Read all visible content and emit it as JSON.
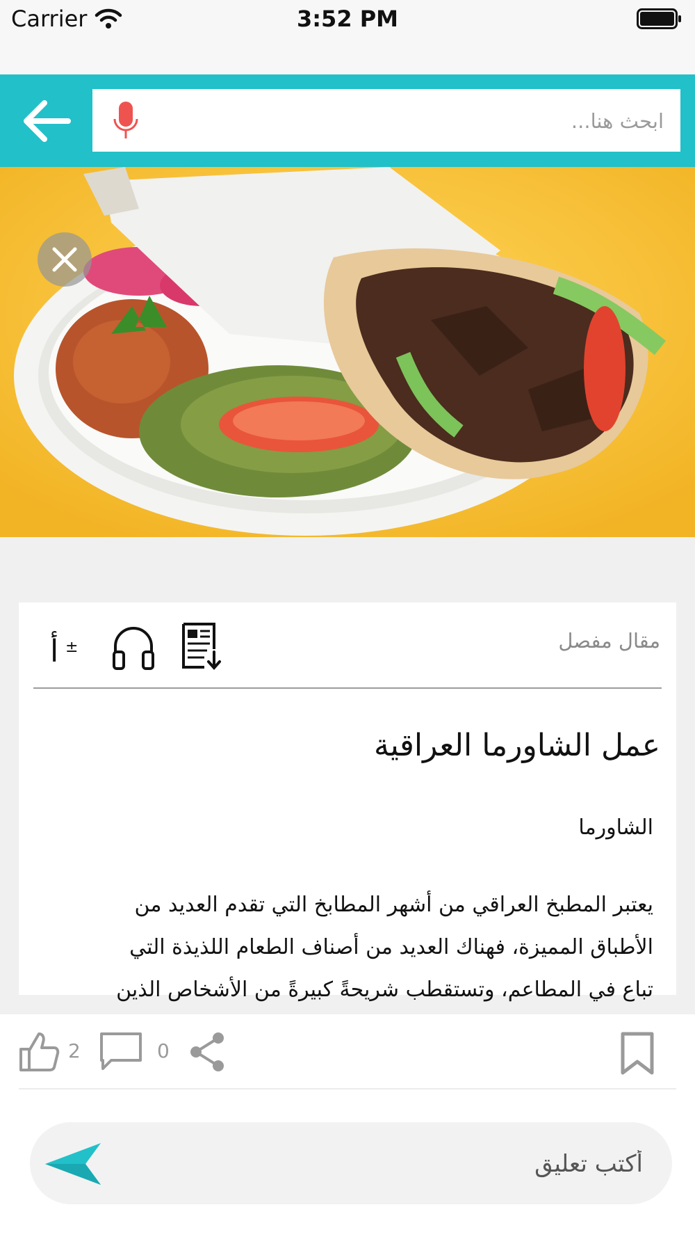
{
  "status_bar": {
    "carrier": "Carrier",
    "time": "3:52 PM",
    "icons": [
      "wifi-icon",
      "battery-icon"
    ]
  },
  "header": {
    "back_icon": "arrow-left-icon",
    "search_placeholder": "ابحث هنا...",
    "mic_icon": "microphone-icon"
  },
  "hero": {
    "image": "shawarma wrap with salads on a plate",
    "close_icon": "close-icon"
  },
  "article": {
    "label": "مقال مفصل",
    "tools": [
      "font-size-icon",
      "headphones-icon",
      "document-download-icon"
    ],
    "title": "عمل الشاورما العراقية",
    "subtitle": "الشاورما",
    "body_lines": [
      "يعتبر المطبخ العراقي من أشهر المطابخ التي تقدم العديد من",
      "الأطباق المميزة، فهناك العديد من أصناف الطعام اللذيذة التي",
      "تباع في المطاعم، وتستقطب شريحةً كبيرةً من الأشخاص الذين"
    ]
  },
  "actions": {
    "likes": "2",
    "comments": "0",
    "icons": [
      "like-icon",
      "comment-icon",
      "share-icon",
      "bookmark-icon"
    ]
  },
  "comment_bar": {
    "placeholder": "أكتب تعليق",
    "send_icon": "send-icon"
  },
  "colors": {
    "accent": "#22c0c9",
    "mic": "#ef5350",
    "icon_gray": "#9a9a9a"
  }
}
